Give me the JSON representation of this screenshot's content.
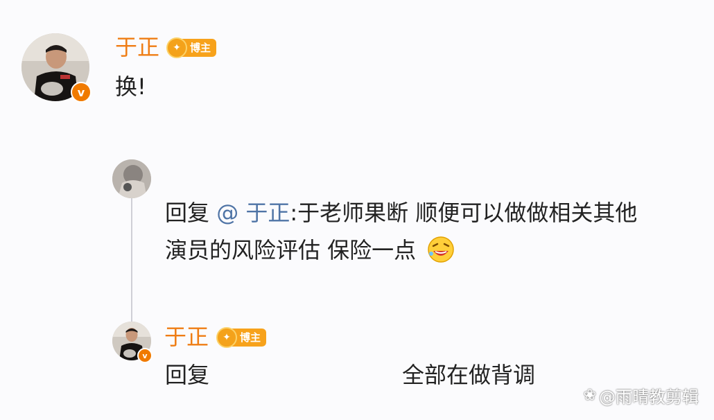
{
  "comment": {
    "author": "于正",
    "badge_label": "博主",
    "verify_mark": "v",
    "text": "换!"
  },
  "reply": {
    "prefix": "回复",
    "mention": "@ 于正",
    "line1_rest": ":于老师果断 顺便可以做做相关其他",
    "line2": "演员的风险评估 保险一点",
    "emoji": "laughing-emoji"
  },
  "reply2": {
    "author": "于正",
    "badge_label": "博主",
    "verify_mark": "v",
    "left_text": "回复",
    "right_text": "全部在做背调"
  },
  "watermark": {
    "text": "@雨晴教剪辑"
  },
  "colors": {
    "author_name": "#ef7d14",
    "mention": "#4f74a6",
    "badge": "#f7a21b",
    "verify": "#f07a00"
  }
}
